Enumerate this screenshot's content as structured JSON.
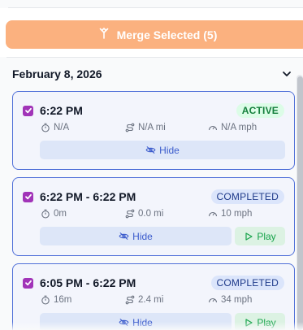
{
  "merge_button": {
    "label": "Merge Selected (5)",
    "icon": "merge-icon"
  },
  "group": {
    "date": "February 8, 2026",
    "toggle_icon": "chevron-down-icon"
  },
  "colors": {
    "accent_orange": "#fbb17f",
    "card_border": "#4f6fd8",
    "checkbox": "#a134b8",
    "active_badge_bg": "#dcfce7",
    "active_badge_text": "#15803d",
    "completed_badge_bg": "#dbe5fb",
    "completed_badge_text": "#1e3a8a"
  },
  "trips": [
    {
      "time": "6:22 PM",
      "status": "ACTIVE",
      "duration": "N/A",
      "distance": "N/A mi",
      "speed": "N/A mph",
      "hide_label": "Hide",
      "play_label": null,
      "checked": true
    },
    {
      "time": "6:22 PM - 6:22 PM",
      "status": "COMPLETED",
      "duration": "0m",
      "distance": "0.0 mi",
      "speed": "10 mph",
      "hide_label": "Hide",
      "play_label": "Play",
      "checked": true
    },
    {
      "time": "6:05 PM - 6:22 PM",
      "status": "COMPLETED",
      "duration": "16m",
      "distance": "2.4 mi",
      "speed": "34 mph",
      "hide_label": "Hide",
      "play_label": "Play",
      "checked": true
    }
  ]
}
